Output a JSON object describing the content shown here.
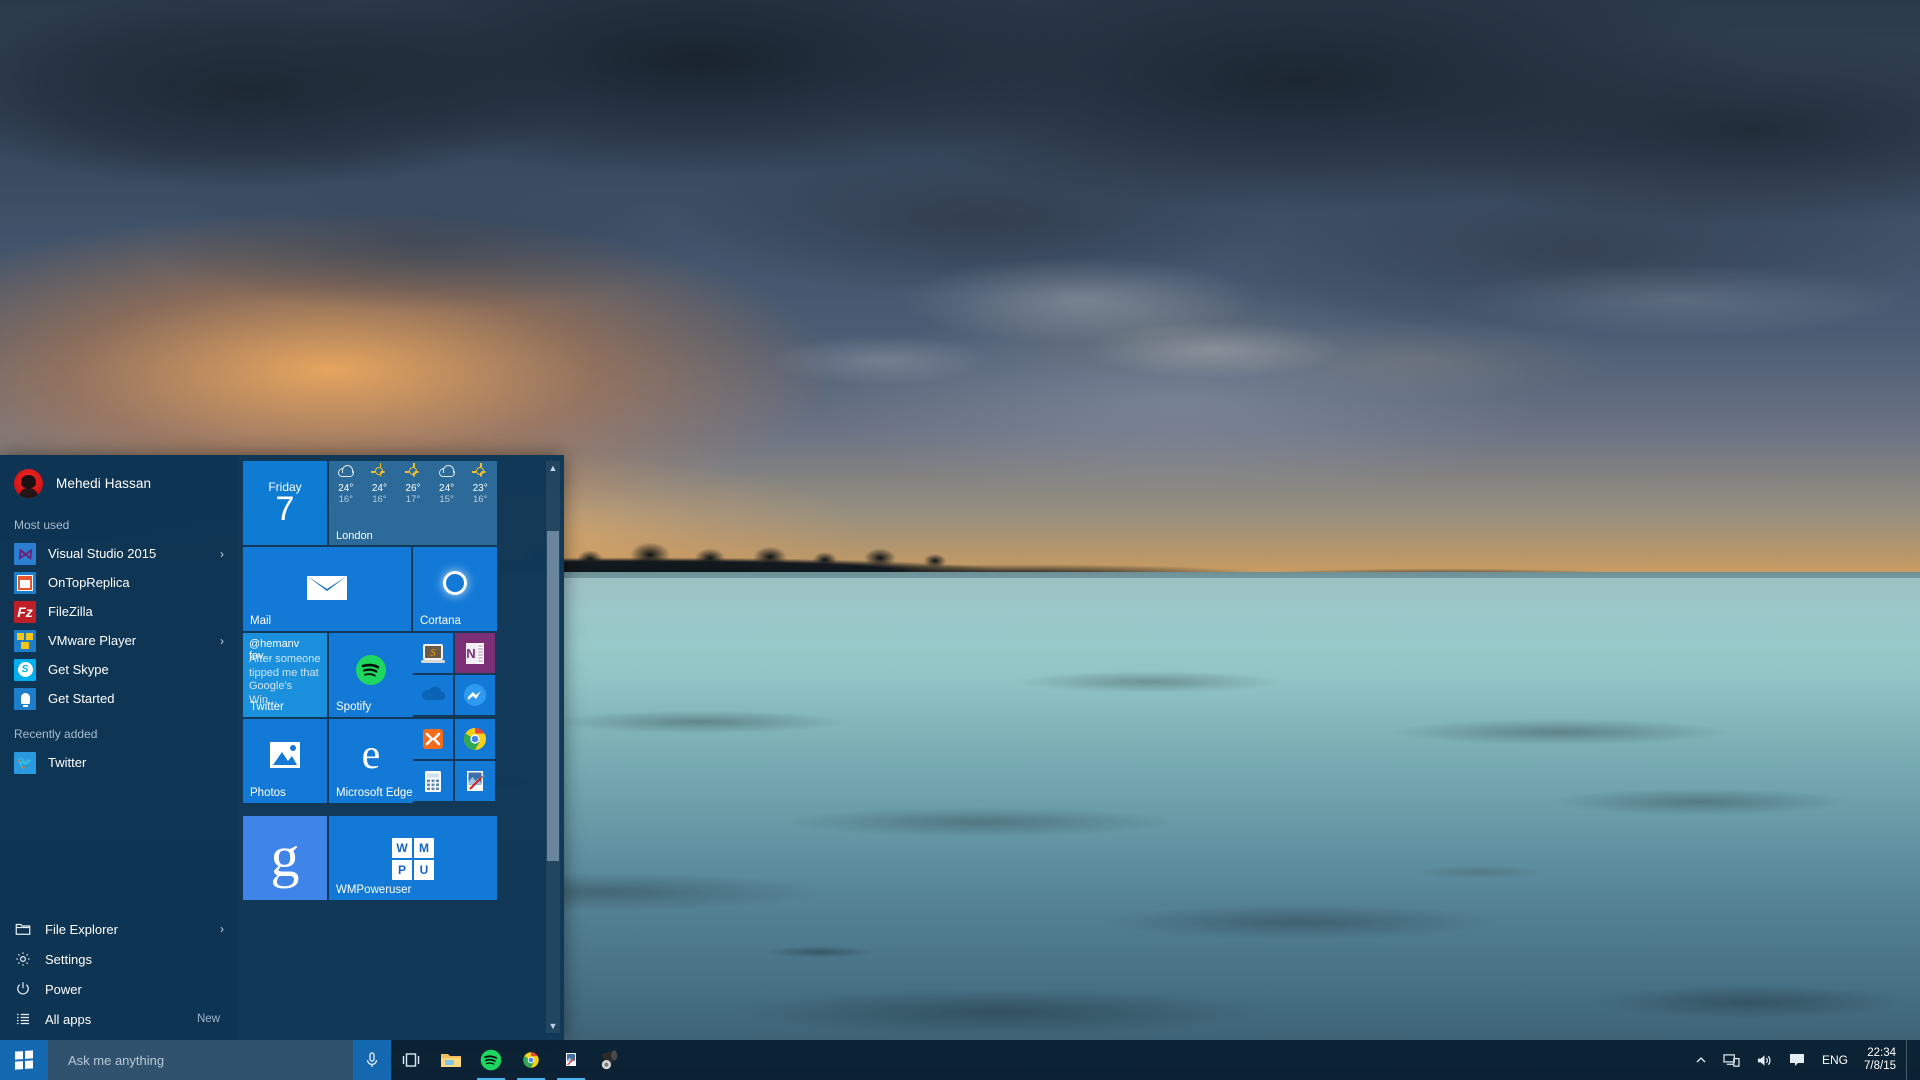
{
  "desktop": {
    "wallpaper_description": "tropical sea at dusk with storm clouds"
  },
  "start_menu": {
    "user": {
      "name": "Mehedi Hassan",
      "avatar": "user-avatar"
    },
    "most_used_label": "Most used",
    "most_used": [
      {
        "label": "Visual Studio 2015",
        "icon": "visual-studio-icon",
        "has_submenu": true
      },
      {
        "label": "OnTopReplica",
        "icon": "ontopreplica-icon",
        "has_submenu": false
      },
      {
        "label": "FileZilla",
        "icon": "filezilla-icon",
        "has_submenu": false
      },
      {
        "label": "VMware Player",
        "icon": "vmware-icon",
        "has_submenu": true
      },
      {
        "label": "Get Skype",
        "icon": "skype-icon",
        "has_submenu": false
      },
      {
        "label": "Get Started",
        "icon": "get-started-icon",
        "has_submenu": false
      }
    ],
    "recently_added_label": "Recently added",
    "recently_added": [
      {
        "label": "Twitter",
        "icon": "twitter-icon",
        "has_submenu": false
      }
    ],
    "system_items": [
      {
        "label": "File Explorer",
        "icon": "folder-icon",
        "has_submenu": true,
        "badge": ""
      },
      {
        "label": "Settings",
        "icon": "gear-icon",
        "has_submenu": false,
        "badge": ""
      },
      {
        "label": "Power",
        "icon": "power-icon",
        "has_submenu": false,
        "badge": ""
      },
      {
        "label": "All apps",
        "icon": "list-icon",
        "has_submenu": false,
        "badge": "New"
      }
    ],
    "tiles": {
      "weather": {
        "day_name": "Friday",
        "day_number": "7",
        "city": "London",
        "forecast": [
          {
            "icon": "cloud",
            "high": "24°",
            "low": "16°"
          },
          {
            "icon": "sun",
            "high": "24°",
            "low": "16°"
          },
          {
            "icon": "sun",
            "high": "26°",
            "low": "17°"
          },
          {
            "icon": "cloud",
            "high": "24°",
            "low": "15°"
          },
          {
            "icon": "sun",
            "high": "23°",
            "low": "16°"
          }
        ]
      },
      "mail": {
        "label": "Mail",
        "icon": "mail-envelope-icon"
      },
      "cortana": {
        "label": "Cortana",
        "icon": "cortana-ring-icon"
      },
      "twitter": {
        "label": "Twitter",
        "headline": "@hemanv fav...",
        "body": "After someone tipped me that Google's Win..."
      },
      "spotify": {
        "label": "Spotify",
        "icon": "spotify-icon"
      },
      "photos": {
        "label": "Photos",
        "icon": "photos-icon"
      },
      "edge": {
        "label": "Microsoft Edge",
        "icon": "edge-icon"
      },
      "small": [
        {
          "name": "snagit",
          "icon": "snagit-icon"
        },
        {
          "name": "onenote",
          "icon": "onenote-icon",
          "letter": "N"
        },
        {
          "name": "onedrive",
          "icon": "onedrive-cloud-icon"
        },
        {
          "name": "messenger",
          "icon": "messenger-icon"
        },
        {
          "name": "xampp",
          "icon": "xampp-icon"
        },
        {
          "name": "chrome",
          "icon": "chrome-icon"
        },
        {
          "name": "calculator",
          "icon": "calculator-icon"
        },
        {
          "name": "paint-net",
          "icon": "paint-net-icon"
        }
      ],
      "google": {
        "letter": "g",
        "icon": "google-icon"
      },
      "wmpoweruser": {
        "label": "WMPoweruser",
        "logo_letters": [
          "W",
          "M",
          "P",
          "U"
        ]
      }
    }
  },
  "taskbar": {
    "start_button": "start-button",
    "search": {
      "placeholder": "Ask me anything",
      "value": ""
    },
    "mic": "microphone-icon",
    "task_view": "task-view-icon",
    "pinned": [
      {
        "name": "file-explorer",
        "icon": "folder-icon",
        "open": false
      },
      {
        "name": "spotify",
        "icon": "spotify-icon",
        "open": true
      },
      {
        "name": "chrome",
        "icon": "chrome-icon",
        "open": true
      },
      {
        "name": "paint-net",
        "icon": "paint-net-icon",
        "open": true
      },
      {
        "name": "audio-app",
        "icon": "speaker-icon",
        "open": false
      }
    ],
    "tray": {
      "chevron": "chevron-up-icon",
      "network": "network-icon",
      "volume": "volume-icon",
      "action_center": "action-center-icon",
      "language": "ENG",
      "time": "22:34",
      "date": "7/8/15"
    }
  }
}
